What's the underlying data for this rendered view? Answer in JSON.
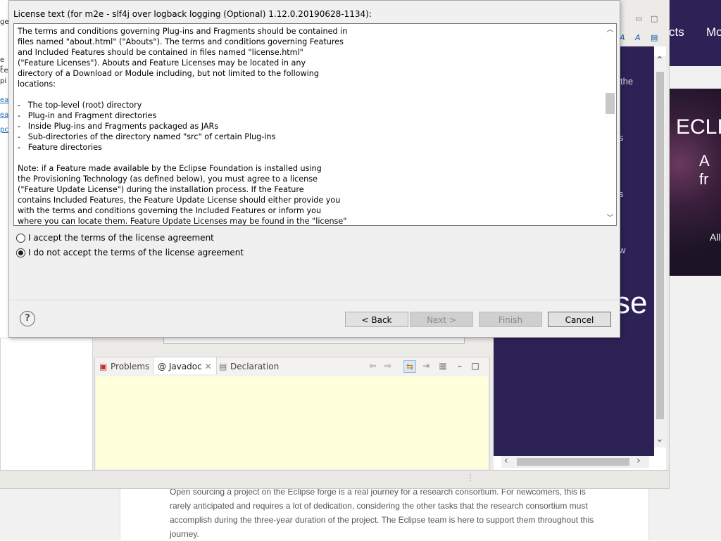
{
  "background": {
    "nav_items": [
      "cts",
      "Mo"
    ],
    "hero": {
      "title": "ECLI",
      "subtitle": "A fr",
      "link": "All"
    },
    "article_text": "Open sourcing a project on the Eclipse forge is a real journey for a research consortium. For newcomers, this is rarely anticipated and requires a lot of dedication, considering the other tasks that the research consortium must accomplish during the three-year duration of the project. The Eclipse team is here to support them throughout this journey."
  },
  "workbench": {
    "left_fragments": [
      "ge",
      "e r",
      "ce",
      "pi",
      "ea",
      "ea",
      "pc"
    ],
    "embedded_browser_words": [
      "the",
      "s",
      "s",
      "w",
      "se"
    ],
    "bottom_tabs": {
      "problems": "Problems",
      "javadoc": "Javadoc",
      "declaration": "Declaration"
    }
  },
  "dialog": {
    "license_title": "License text (for m2e - slf4j over logback logging (Optional) 1.12.0.20190628-1134):",
    "license_lines": [
      "The terms and conditions governing Plug-ins and Fragments should be contained in",
      "files named \"about.html\" (\"Abouts\"). The terms and conditions governing Features",
      "and Included Features should be contained in files named \"license.html\"",
      "(\"Feature Licenses\"). Abouts and Feature Licenses may be located in any",
      "directory of a Download or Module including, but not limited to the following",
      "locations:",
      "",
      "-   The top-level (root) directory",
      "-   Plug-in and Fragment directories",
      "-   Inside Plug-ins and Fragments packaged as JARs",
      "-   Sub-directories of the directory named \"src\" of certain Plug-ins",
      "-   Feature directories",
      "",
      "Note: if a Feature made available by the Eclipse Foundation is installed using",
      "the Provisioning Technology (as defined below), you must agree to a license",
      "(\"Feature Update License\") during the installation process. If the Feature",
      "contains Included Features, the Feature Update License should either provide you",
      "with the terms and conditions governing the Included Features or inform you",
      "where you can locate them. Feature Update Licenses may be found in the \"license\""
    ],
    "radio_accept": "I accept the terms of the license agreement",
    "radio_decline": "I do not accept the terms of the license agreement",
    "selected": "decline",
    "buttons": {
      "help": "?",
      "back": "< Back",
      "next": "Next >",
      "finish": "Finish",
      "cancel": "Cancel"
    }
  }
}
